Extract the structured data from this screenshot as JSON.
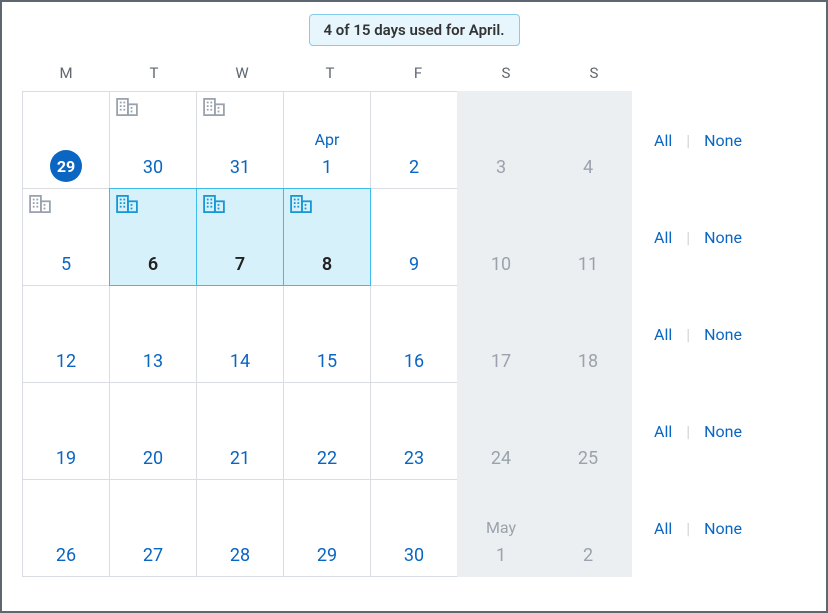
{
  "banner": {
    "text": "4 of 15 days used for April."
  },
  "dow": [
    "M",
    "T",
    "W",
    "T",
    "F",
    "S",
    "S"
  ],
  "actions": {
    "all": "All",
    "none": "None"
  },
  "icons": {
    "building": "building-icon"
  },
  "weeks": [
    {
      "days": [
        {
          "num": "29",
          "today": true
        },
        {
          "num": "30",
          "prev": true,
          "icon": true
        },
        {
          "num": "31",
          "prev": true,
          "icon": true
        },
        {
          "num": "1",
          "monthLabel": "Apr"
        },
        {
          "num": "2"
        },
        {
          "num": "3",
          "weekend": true
        },
        {
          "num": "4",
          "weekend": true
        }
      ]
    },
    {
      "days": [
        {
          "num": "5",
          "icon": true
        },
        {
          "num": "6",
          "selected": true,
          "icon": true
        },
        {
          "num": "7",
          "selected": true,
          "icon": true
        },
        {
          "num": "8",
          "selected": true,
          "icon": true
        },
        {
          "num": "9"
        },
        {
          "num": "10",
          "weekend": true
        },
        {
          "num": "11",
          "weekend": true
        }
      ]
    },
    {
      "days": [
        {
          "num": "12"
        },
        {
          "num": "13"
        },
        {
          "num": "14"
        },
        {
          "num": "15"
        },
        {
          "num": "16"
        },
        {
          "num": "17",
          "weekend": true
        },
        {
          "num": "18",
          "weekend": true
        }
      ]
    },
    {
      "days": [
        {
          "num": "19"
        },
        {
          "num": "20"
        },
        {
          "num": "21"
        },
        {
          "num": "22"
        },
        {
          "num": "23"
        },
        {
          "num": "24",
          "weekend": true
        },
        {
          "num": "25",
          "weekend": true
        }
      ]
    },
    {
      "days": [
        {
          "num": "26"
        },
        {
          "num": "27"
        },
        {
          "num": "28"
        },
        {
          "num": "29"
        },
        {
          "num": "30"
        },
        {
          "num": "1",
          "weekend": true,
          "monthLabel": "May"
        },
        {
          "num": "2",
          "weekend": true
        }
      ]
    }
  ]
}
